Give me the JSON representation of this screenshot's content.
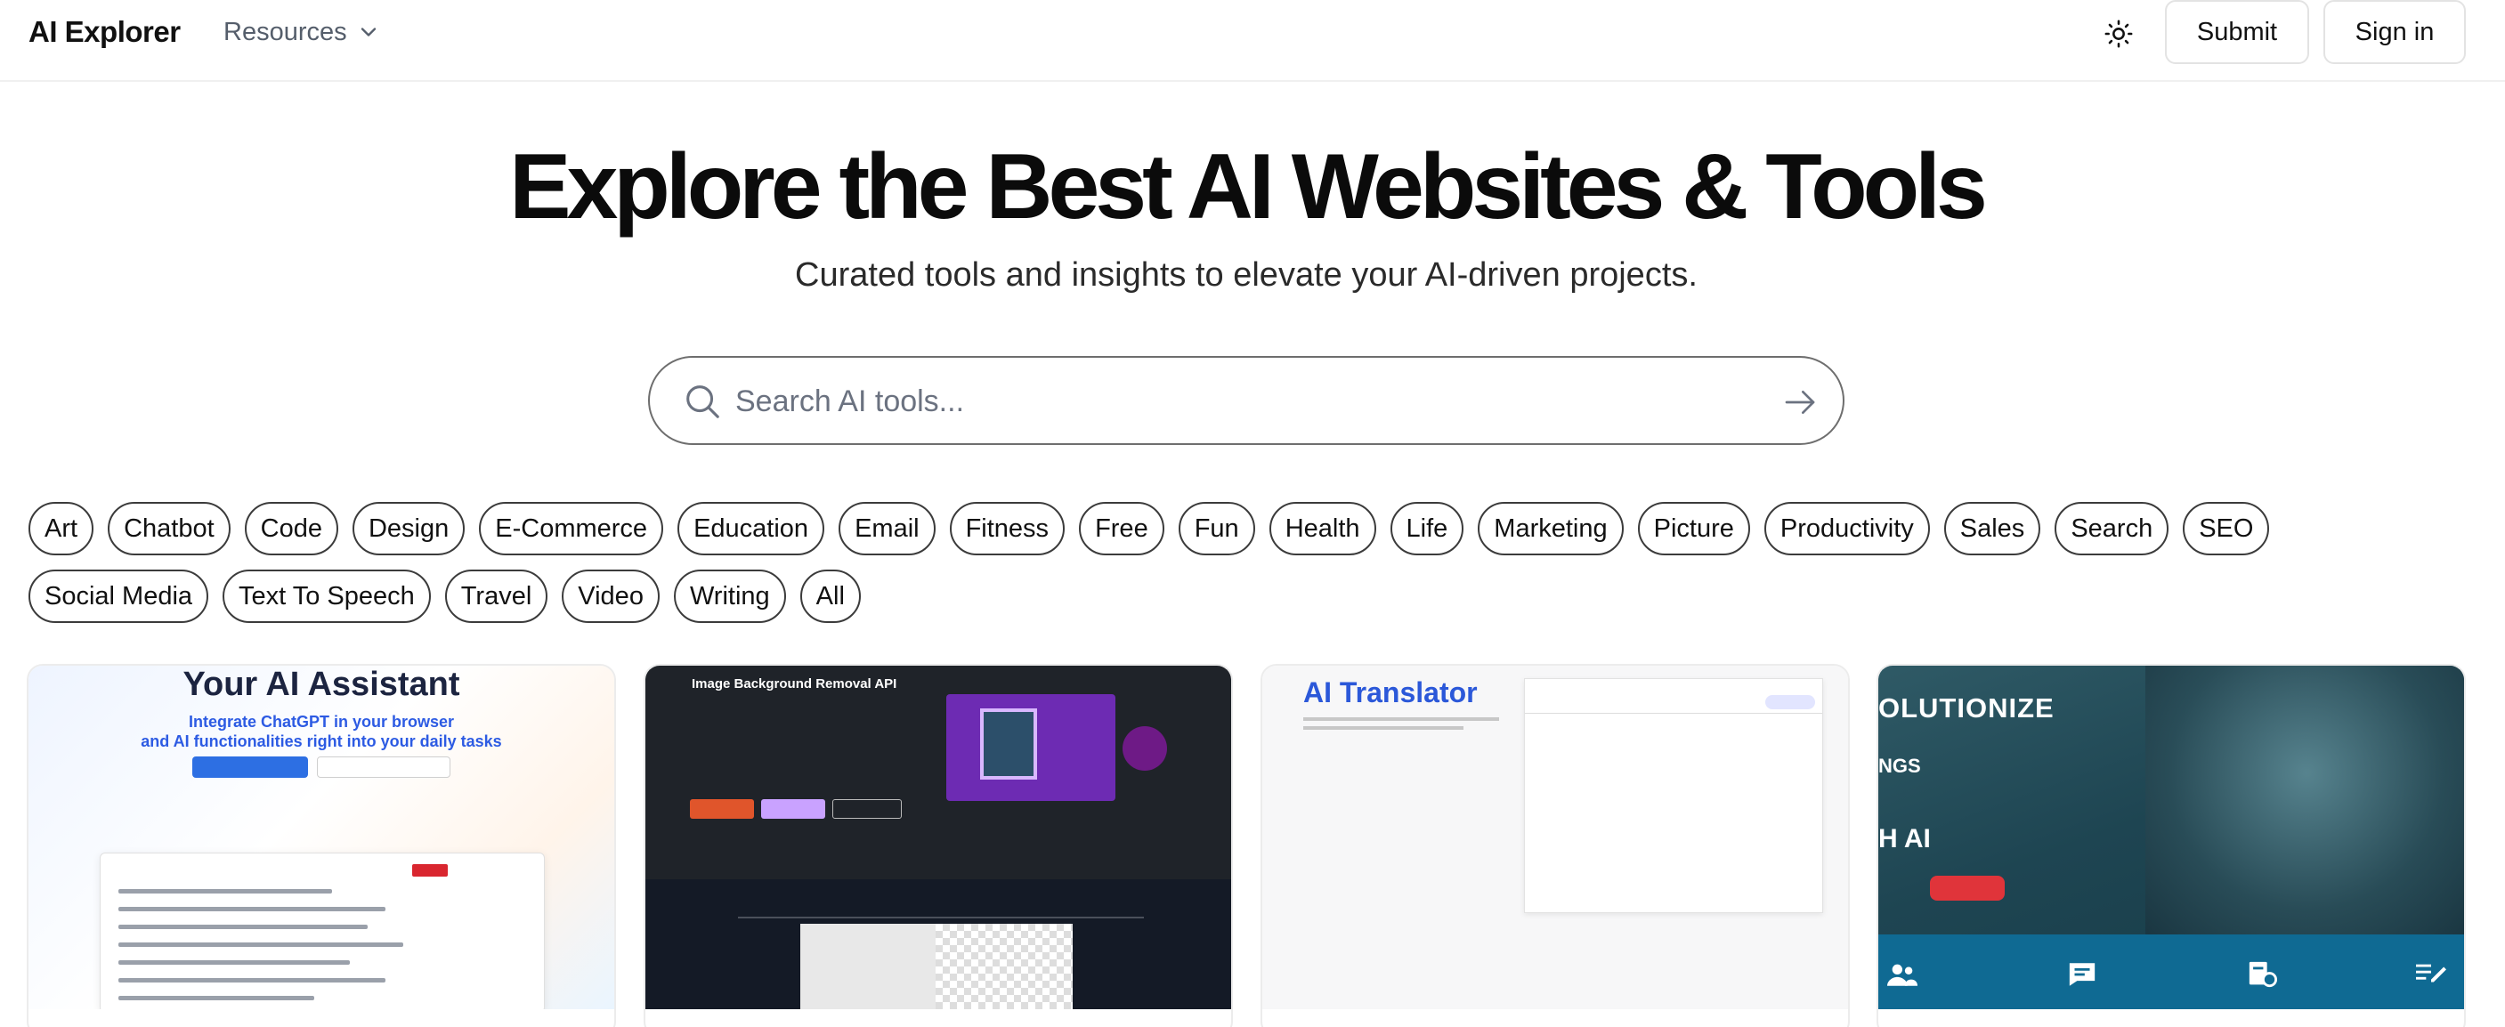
{
  "header": {
    "logo": "AI Explorer",
    "resources_label": "Resources",
    "submit_label": "Submit",
    "signin_label": "Sign in"
  },
  "hero": {
    "title": "Explore the Best AI Websites & Tools",
    "subtitle": "Curated tools and insights to elevate your AI-driven projects."
  },
  "search": {
    "placeholder": "Search AI tools...",
    "value": ""
  },
  "categories_row1": [
    "Art",
    "Chatbot",
    "Code",
    "Design",
    "E-Commerce",
    "Education",
    "Email",
    "Fitness",
    "Free",
    "Fun",
    "Health",
    "Life",
    "Marketing",
    "Picture",
    "Productivity",
    "Sales",
    "Search",
    "SEO"
  ],
  "categories_row2": [
    "Social Media",
    "Text To Speech",
    "Travel",
    "Video",
    "Writing",
    "All"
  ],
  "cards": [
    {
      "headline": "Your AI Assistant",
      "tagline_1": "Integrate ChatGPT in your browser",
      "tagline_2": "and AI functionalities right into your daily tasks"
    },
    {
      "headline": "Image Background Removal API"
    },
    {
      "headline": "AI Translator"
    },
    {
      "headline": "OLUTIONIZE",
      "line_2": "NGS",
      "line_3": "H AI"
    }
  ],
  "icons": {
    "theme": "sun-icon",
    "search": "search-icon",
    "submit_search": "arrow-right-icon",
    "resources": "chevron-down-icon"
  },
  "colors": {
    "accent_blue": "#2d5be3",
    "text": "#111111",
    "muted": "#555e6b"
  }
}
